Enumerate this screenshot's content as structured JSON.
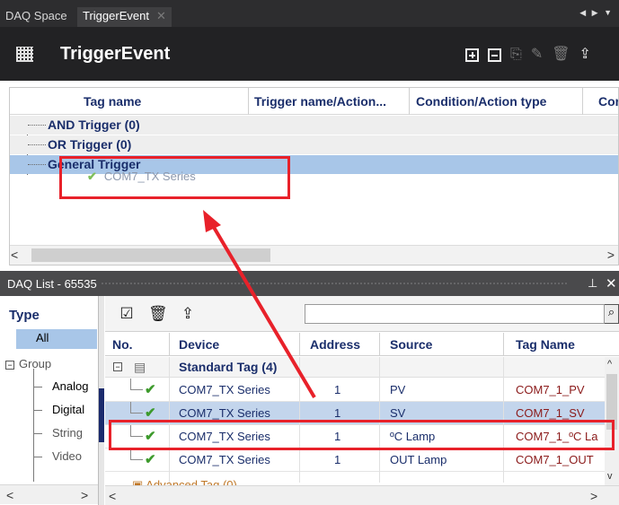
{
  "tabs": [
    {
      "label": "DAQ Space"
    },
    {
      "label": "TriggerEvent"
    }
  ],
  "header": {
    "title": "TriggerEvent"
  },
  "trigger_panel": {
    "columns": [
      "Tag name",
      "Trigger name/Action...",
      "Condition/Action type",
      "Cor"
    ],
    "rows": [
      {
        "label": "AND Trigger (0)"
      },
      {
        "label": "OR Trigger (0)"
      },
      {
        "label": "General Trigger"
      }
    ],
    "drag_item": "COM7_TX Series"
  },
  "daq_list": {
    "title": "DAQ List - 65535",
    "type_panel": {
      "header": "Type",
      "items": [
        "All",
        "Group",
        "Analog",
        "Digital",
        "String",
        "Video"
      ]
    },
    "search": {
      "value": "",
      "placeholder": ""
    },
    "columns": [
      "No.",
      "Device",
      "Address",
      "Source",
      "Tag Name"
    ],
    "group_label": "Standard Tag (4)",
    "rows": [
      {
        "device": "COM7_TX Series",
        "address": "1",
        "source": "PV",
        "tag": "COM7_1_PV"
      },
      {
        "device": "COM7_TX Series",
        "address": "1",
        "source": "SV",
        "tag": "COM7_1_SV"
      },
      {
        "device": "COM7_TX Series",
        "address": "1",
        "source": "ºC Lamp",
        "tag": "COM7_1_ºC La"
      },
      {
        "device": "COM7_TX Series",
        "address": "1",
        "source": "OUT Lamp",
        "tag": "COM7_1_OUT"
      }
    ],
    "partial_group": "Advanced Tag (0)"
  },
  "colors": {
    "accent_red": "#e8212a",
    "selection_blue": "#a8c6e8",
    "header_navy": "#1a2e6b",
    "tag_red": "#8b1a1a",
    "check_green": "#3d9a2c"
  },
  "icons": [
    "grid-icon",
    "add-icon",
    "remove-icon",
    "copy-icon",
    "edit-icon",
    "delete-icon",
    "export-icon",
    "check-icon",
    "search-icon",
    "pin-icon",
    "close-icon",
    "tag-group-icon"
  ]
}
